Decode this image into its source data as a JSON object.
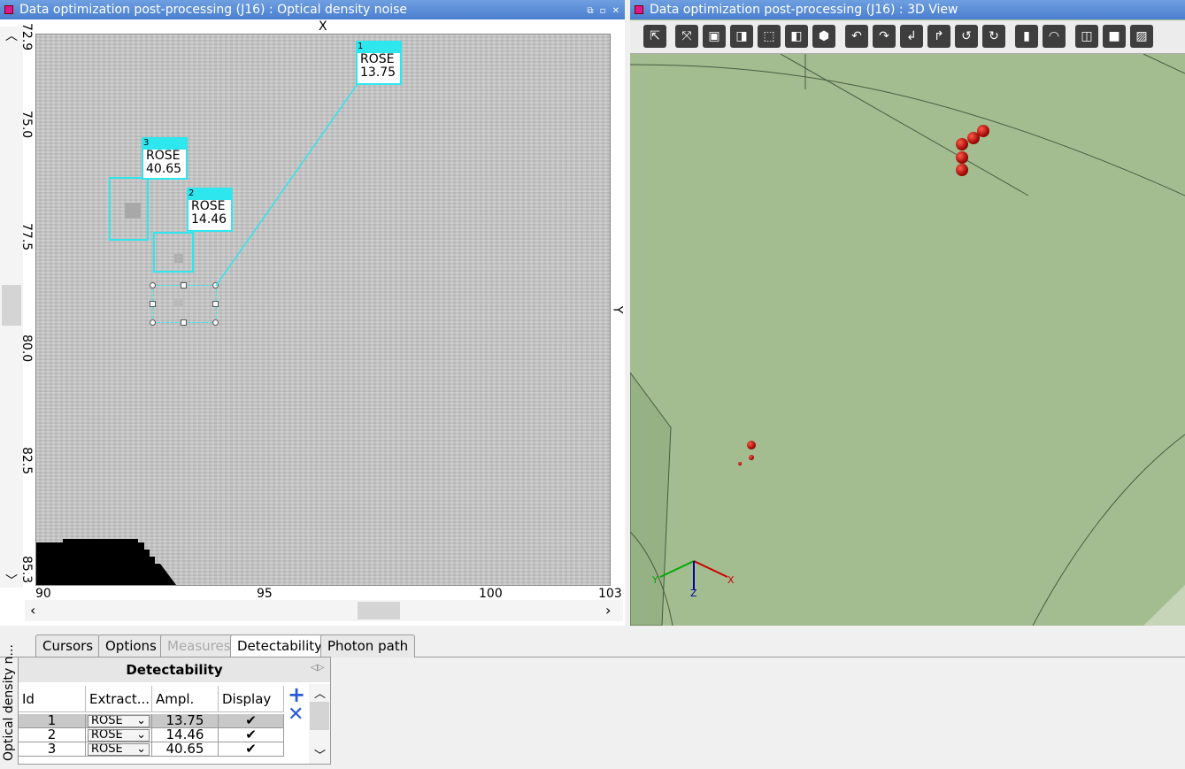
{
  "left_window": {
    "title": "Data optimization post-processing (J16) : Optical density noise",
    "controls": "⧉ ▫ ✕",
    "x_axis_label": "X",
    "y_axis_label": "Y",
    "x_ticks": [
      "90",
      "95",
      "100",
      "103"
    ],
    "y_ticks": [
      "72.9",
      "75.0",
      "77.5",
      "80.0",
      "82.5",
      "85.3"
    ],
    "rois": [
      {
        "id": "1",
        "method": "ROSE",
        "value": "13.75"
      },
      {
        "id": "2",
        "method": "ROSE",
        "value": "14.46"
      },
      {
        "id": "3",
        "method": "ROSE",
        "value": "40.65"
      }
    ]
  },
  "right_window": {
    "title": "Data optimization post-processing (J16) : 3D View",
    "toolbar_icons": [
      "select-icon",
      "fit-icon",
      "cube-front-icon",
      "cube-red-icon",
      "cube-wire-icon",
      "cube-side-icon",
      "cube-iso-icon",
      "rotate-left-icon",
      "rotate-right-icon",
      "rotate-down-icon",
      "rotate-up-icon",
      "rotate-ccw-icon",
      "rotate-cw-icon",
      "ruler-icon",
      "protractor-icon",
      "box-icon",
      "solid-icon",
      "hatch-icon"
    ],
    "axis_labels": {
      "x": "X",
      "y": "Y",
      "z": "Z"
    },
    "colors": {
      "background": "#a3bd90",
      "spheres": "#c4160c"
    }
  },
  "bottom_panel": {
    "side_label": "Optical density n...",
    "tabs": [
      {
        "label": "Cursors",
        "state": "normal"
      },
      {
        "label": "Options",
        "state": "normal"
      },
      {
        "label": "Measures",
        "state": "disabled"
      },
      {
        "label": "Detectability",
        "state": "active"
      },
      {
        "label": "Photon path",
        "state": "normal"
      }
    ],
    "detectability": {
      "title": "Detectability",
      "columns": [
        "Id",
        "Extract...",
        "Ampl.",
        "Display"
      ],
      "rows": [
        {
          "id": "1",
          "extract": "ROSE",
          "ampl": "13.75",
          "display": "✔"
        },
        {
          "id": "2",
          "extract": "ROSE",
          "ampl": "14.46",
          "display": "✔"
        },
        {
          "id": "3",
          "extract": "ROSE",
          "ampl": "40.65",
          "display": "✔"
        }
      ],
      "add_label": "+",
      "remove_label": "✕"
    }
  }
}
